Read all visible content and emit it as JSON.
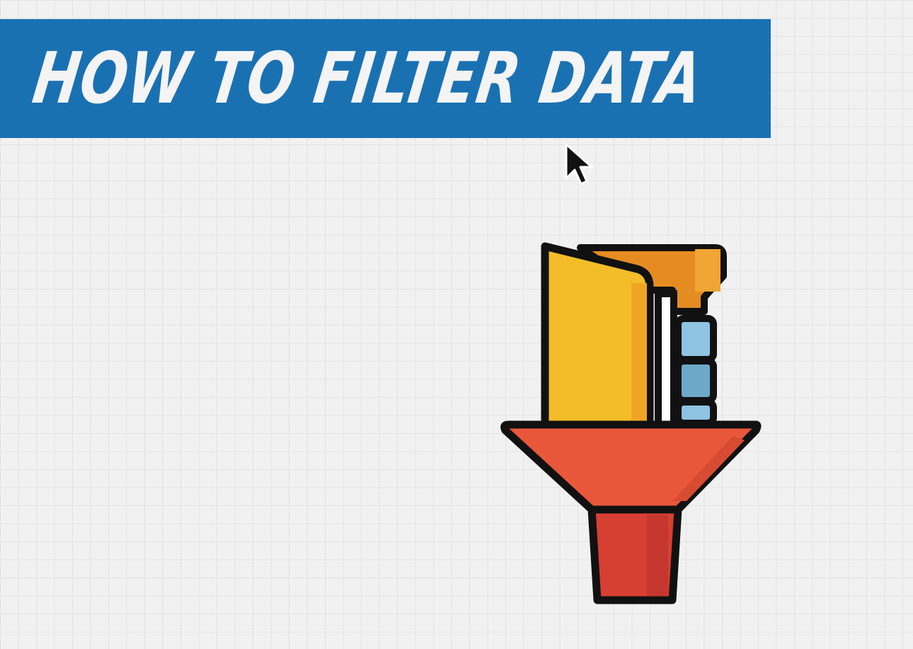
{
  "title": {
    "text": "HOW TO FILTER DATA"
  },
  "colors": {
    "background": "#f1f1f1",
    "grid_line": "#e2e2e2",
    "banner": "#1a71b2",
    "title_text": "#f4f4f4",
    "outline": "#111111",
    "folder_yellow": "#f3bd2a",
    "folder_orange": "#e48c22",
    "funnel_top": "#e9573b",
    "funnel_stem": "#d83f33",
    "paper_blue": "#8fc3e2"
  },
  "icons": {
    "cursor": "mouse-pointer-icon",
    "illustration": "folder-funnel-filter-icon"
  }
}
